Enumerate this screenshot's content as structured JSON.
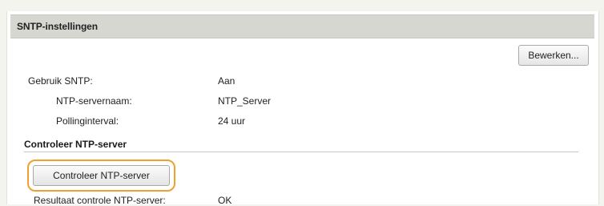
{
  "header": {
    "title": "SNTP-instellingen"
  },
  "toolbar": {
    "edit_label": "Bewerken..."
  },
  "settings": {
    "rows": [
      {
        "label": "Gebruik SNTP:",
        "value": "Aan"
      },
      {
        "label": "NTP-servernaam:",
        "value": "NTP_Server"
      },
      {
        "label": "Pollinginterval:",
        "value": "24 uur"
      }
    ]
  },
  "check_section": {
    "title": "Controleer NTP-server",
    "button_label": "Controleer NTP-server",
    "highlight_color": "#f0a030",
    "result_label": "Resultaat controle NTP-server:",
    "result_value": "OK"
  }
}
